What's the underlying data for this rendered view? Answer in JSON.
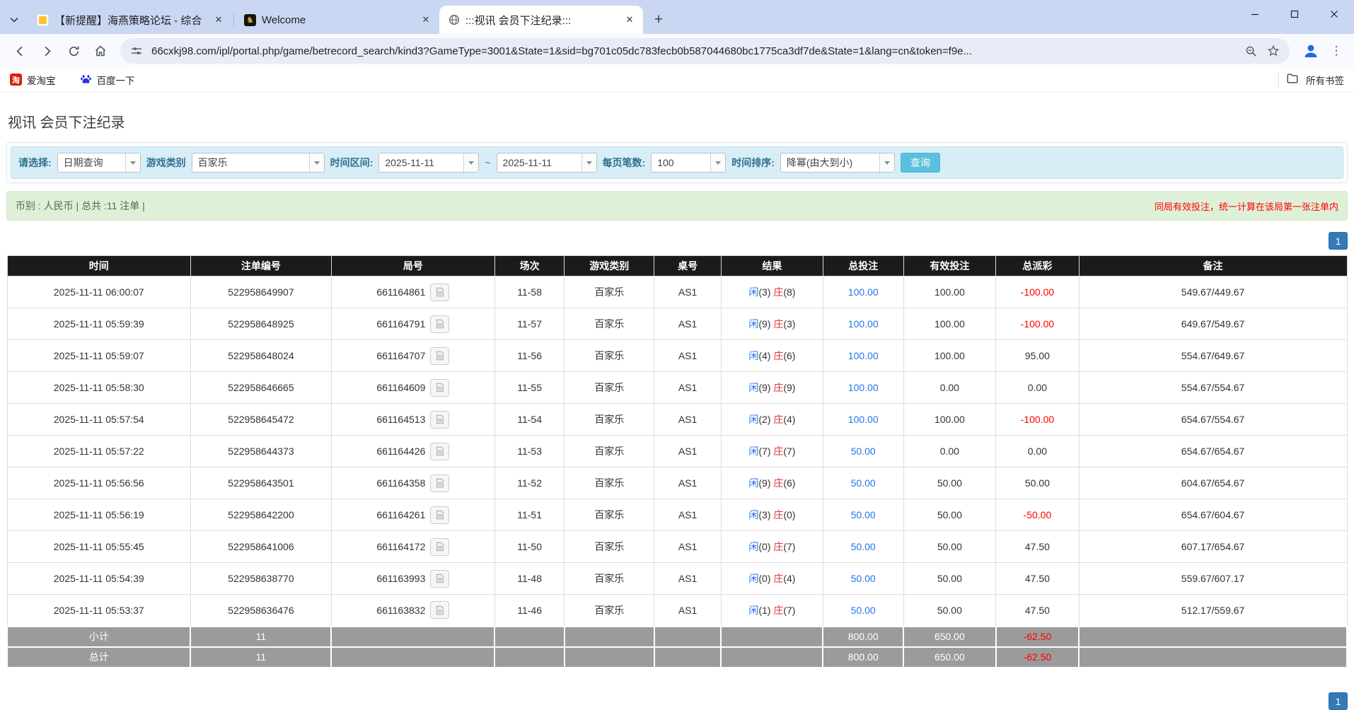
{
  "colors": {
    "theme_periwinkle": "#c9d7f2",
    "table_header_bg": "#1b1b1b",
    "footer_gray": "#9b9b9b",
    "link_blue": "#2277e6",
    "alert_red": "#ff0000",
    "filter_panel_bg": "#d9edf7",
    "info_bar_bg": "#dff0d8",
    "pagination_blue": "#337ab7",
    "search_button_bg": "#5bc0de"
  },
  "browser": {
    "tabs": [
      {
        "title": "【新提醒】海燕策略论坛 - 综合",
        "icon": "chat-page",
        "active": false
      },
      {
        "title": "Welcome",
        "icon": "gold-horse",
        "active": false
      },
      {
        "title": ":::视讯 会员下注纪录:::",
        "icon": "globe",
        "active": true
      }
    ],
    "url": "66cxkj98.com/ipl/portal.php/game/betrecord_search/kind3?GameType=3001&State=1&sid=bg701c05dc783fecb0b587044680bc1775ca3df7de&State=1&lang=cn&token=f9e...",
    "bookmarks": [
      {
        "label": "爱淘宝",
        "icon": "taobao"
      },
      {
        "label": "百度一下",
        "icon": "baidu-paw"
      }
    ],
    "all_bookmarks_label": "所有书签",
    "taobao_glyph": "淘"
  },
  "page": {
    "title": "视讯 会员下注纪录",
    "filters": {
      "select_label": "请选择:",
      "select_value": "日期查询",
      "game_type_label": "游戏类别",
      "game_type_value": "百家乐",
      "time_range_label": "时间区间:",
      "date_from": "2025-11-11",
      "tilde": "~",
      "date_to": "2025-11-11",
      "page_size_label": "每页笔数:",
      "page_size_value": "100",
      "sort_label": "时间排序:",
      "sort_value": "降幂(由大到小)",
      "search_button": "查询"
    },
    "info_bar": {
      "left": "币别 : 人民币 | 总共 :11 注单 |",
      "right": "同局有效投注，统一计算在该局第一张注单内"
    },
    "pagination": {
      "current": "1"
    },
    "table": {
      "headers": [
        "时间",
        "注单编号",
        "局号",
        "场次",
        "游戏类别",
        "桌号",
        "结果",
        "总投注",
        "有效投注",
        "总派彩",
        "备注"
      ],
      "rows": [
        {
          "time": "2025-11-11 06:00:07",
          "bet_id": "522958649907",
          "round": "661164861",
          "session": "11-58",
          "game": "百家乐",
          "table_no": "AS1",
          "result": {
            "player": "闲",
            "player_score": "(3)",
            "banker": "庄",
            "banker_score": "(8)"
          },
          "total_bet": "100.00",
          "valid_bet": "100.00",
          "payout": "-100.00",
          "note": "549.67/449.67"
        },
        {
          "time": "2025-11-11 05:59:39",
          "bet_id": "522958648925",
          "round": "661164791",
          "session": "11-57",
          "game": "百家乐",
          "table_no": "AS1",
          "result": {
            "player": "闲",
            "player_score": "(9)",
            "banker": "庄",
            "banker_score": "(3)"
          },
          "total_bet": "100.00",
          "valid_bet": "100.00",
          "payout": "-100.00",
          "note": "649.67/549.67"
        },
        {
          "time": "2025-11-11 05:59:07",
          "bet_id": "522958648024",
          "round": "661164707",
          "session": "11-56",
          "game": "百家乐",
          "table_no": "AS1",
          "result": {
            "player": "闲",
            "player_score": "(4)",
            "banker": "庄",
            "banker_score": "(6)"
          },
          "total_bet": "100.00",
          "valid_bet": "100.00",
          "payout": "95.00",
          "note": "554.67/649.67"
        },
        {
          "time": "2025-11-11 05:58:30",
          "bet_id": "522958646665",
          "round": "661164609",
          "session": "11-55",
          "game": "百家乐",
          "table_no": "AS1",
          "result": {
            "player": "闲",
            "player_score": "(9)",
            "banker": "庄",
            "banker_score": "(9)"
          },
          "total_bet": "100.00",
          "valid_bet": "0.00",
          "payout": "0.00",
          "note": "554.67/554.67"
        },
        {
          "time": "2025-11-11 05:57:54",
          "bet_id": "522958645472",
          "round": "661164513",
          "session": "11-54",
          "game": "百家乐",
          "table_no": "AS1",
          "result": {
            "player": "闲",
            "player_score": "(2)",
            "banker": "庄",
            "banker_score": "(4)"
          },
          "total_bet": "100.00",
          "valid_bet": "100.00",
          "payout": "-100.00",
          "note": "654.67/554.67"
        },
        {
          "time": "2025-11-11 05:57:22",
          "bet_id": "522958644373",
          "round": "661164426",
          "session": "11-53",
          "game": "百家乐",
          "table_no": "AS1",
          "result": {
            "player": "闲",
            "player_score": "(7)",
            "banker": "庄",
            "banker_score": "(7)"
          },
          "total_bet": "50.00",
          "valid_bet": "0.00",
          "payout": "0.00",
          "note": "654.67/654.67"
        },
        {
          "time": "2025-11-11 05:56:56",
          "bet_id": "522958643501",
          "round": "661164358",
          "session": "11-52",
          "game": "百家乐",
          "table_no": "AS1",
          "result": {
            "player": "闲",
            "player_score": "(9)",
            "banker": "庄",
            "banker_score": "(6)"
          },
          "total_bet": "50.00",
          "valid_bet": "50.00",
          "payout": "50.00",
          "note": "604.67/654.67"
        },
        {
          "time": "2025-11-11 05:56:19",
          "bet_id": "522958642200",
          "round": "661164261",
          "session": "11-51",
          "game": "百家乐",
          "table_no": "AS1",
          "result": {
            "player": "闲",
            "player_score": "(3)",
            "banker": "庄",
            "banker_score": "(0)"
          },
          "total_bet": "50.00",
          "valid_bet": "50.00",
          "payout": "-50.00",
          "note": "654.67/604.67"
        },
        {
          "time": "2025-11-11 05:55:45",
          "bet_id": "522958641006",
          "round": "661164172",
          "session": "11-50",
          "game": "百家乐",
          "table_no": "AS1",
          "result": {
            "player": "闲",
            "player_score": "(0)",
            "banker": "庄",
            "banker_score": "(7)"
          },
          "total_bet": "50.00",
          "valid_bet": "50.00",
          "payout": "47.50",
          "note": "607.17/654.67"
        },
        {
          "time": "2025-11-11 05:54:39",
          "bet_id": "522958638770",
          "round": "661163993",
          "session": "11-48",
          "game": "百家乐",
          "table_no": "AS1",
          "result": {
            "player": "闲",
            "player_score": "(0)",
            "banker": "庄",
            "banker_score": "(4)"
          },
          "total_bet": "50.00",
          "valid_bet": "50.00",
          "payout": "47.50",
          "note": "559.67/607.17"
        },
        {
          "time": "2025-11-11 05:53:37",
          "bet_id": "522958636476",
          "round": "661163832",
          "session": "11-46",
          "game": "百家乐",
          "table_no": "AS1",
          "result": {
            "player": "闲",
            "player_score": "(1)",
            "banker": "庄",
            "banker_score": "(7)"
          },
          "total_bet": "50.00",
          "valid_bet": "50.00",
          "payout": "47.50",
          "note": "512.17/559.67"
        }
      ],
      "footer": [
        {
          "label": "小计",
          "count": "11",
          "total_bet": "800.00",
          "valid_bet": "650.00",
          "payout": "-62.50"
        },
        {
          "label": "总计",
          "count": "11",
          "total_bet": "800.00",
          "valid_bet": "650.00",
          "payout": "-62.50"
        }
      ]
    }
  }
}
